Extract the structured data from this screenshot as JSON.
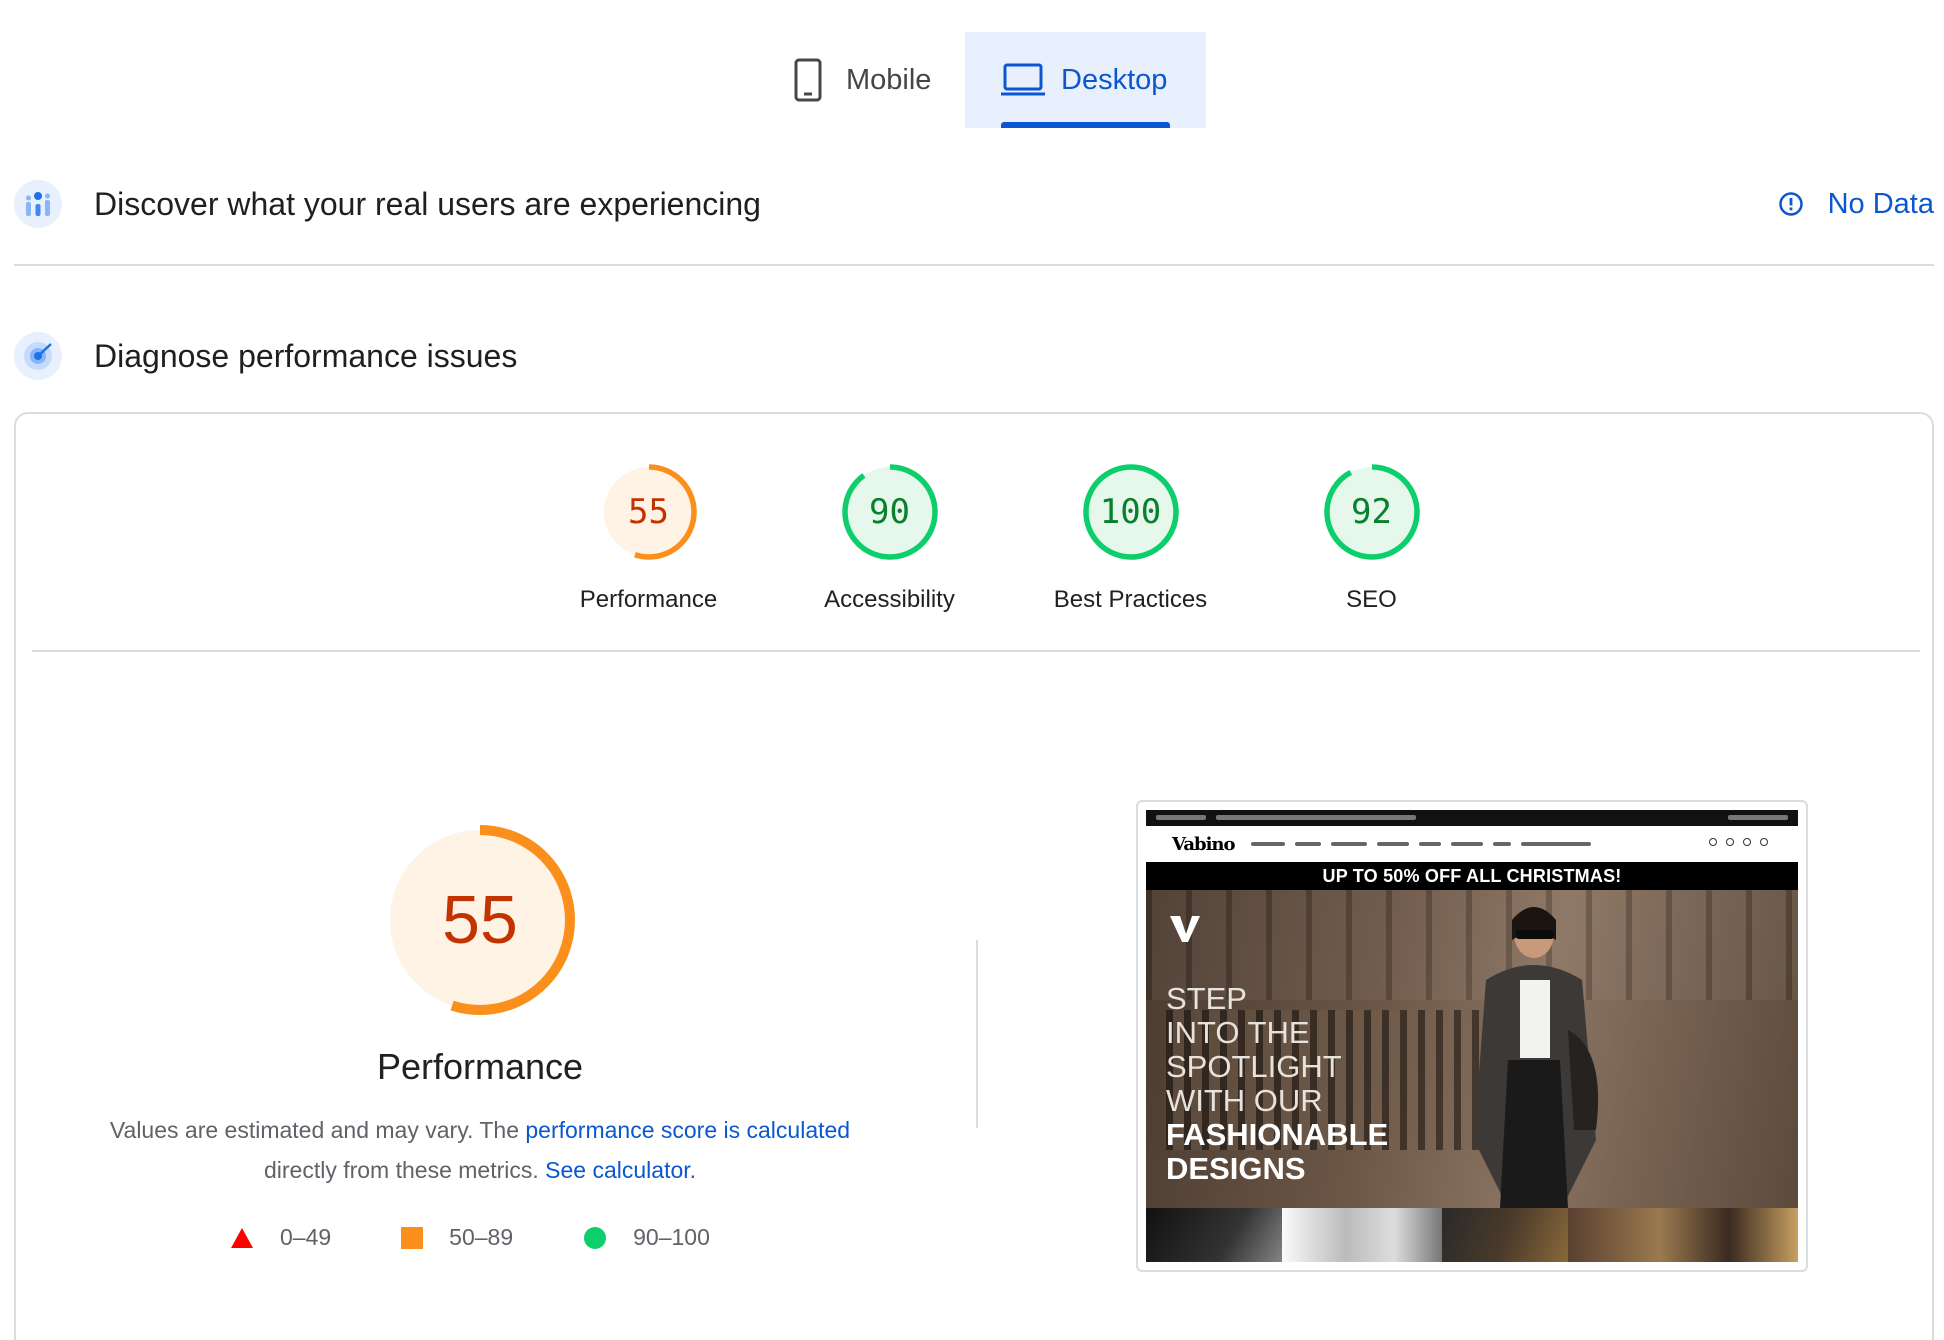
{
  "tabs": {
    "mobile_label": "Mobile",
    "desktop_label": "Desktop",
    "active": "Desktop"
  },
  "crux": {
    "title": "Discover what your real users are experiencing",
    "status": "No Data"
  },
  "diagnose": {
    "title": "Diagnose performance issues"
  },
  "categories": [
    {
      "label": "Performance",
      "score": "55",
      "value": 55,
      "color": "#fa901b",
      "text_color": "#c33300",
      "fill": "#fff3e6"
    },
    {
      "label": "Accessibility",
      "score": "90",
      "value": 90,
      "color": "#0cce6b",
      "text_color": "#08802c",
      "fill": "#e6f7ec"
    },
    {
      "label": "Best Practices",
      "score": "100",
      "value": 100,
      "color": "#0cce6b",
      "text_color": "#08802c",
      "fill": "#e6f7ec"
    },
    {
      "label": "SEO",
      "score": "92",
      "value": 92,
      "color": "#0cce6b",
      "text_color": "#08802c",
      "fill": "#e6f7ec"
    }
  ],
  "performance": {
    "score": "55",
    "value": 55,
    "title": "Performance",
    "desc_prefix": "Values are estimated and may vary. The ",
    "desc_link1": "performance score is calculated",
    "desc_middle": " directly from these metrics. ",
    "desc_link2": "See calculator."
  },
  "legend": [
    {
      "range": "0–49",
      "shape": "triangle",
      "color": "#ff0000"
    },
    {
      "range": "50–89",
      "shape": "square",
      "color": "#fa901b"
    },
    {
      "range": "90–100",
      "shape": "circle",
      "color": "#0cce6b"
    }
  ],
  "screenshot": {
    "logo": "Vabino",
    "banner": "UP TO 50% OFF ALL CHRISTMAS!",
    "hero_line1": "STEP",
    "hero_line2": "INTO THE",
    "hero_line3": "SPOTLIGHT",
    "hero_line4": "WITH OUR",
    "hero_line5": "FASHIONABLE",
    "hero_line6": "DESIGNS"
  },
  "icons": {
    "mobile": "phone-icon",
    "desktop": "laptop-icon",
    "crux": "crux-chart-icon",
    "diagnose": "lighthouse-target-icon",
    "info": "info-icon"
  },
  "colors": {
    "accent": "#0b57d0",
    "tab_active_bg": "#e8f0fe",
    "fail": "#ff0000",
    "average": "#fa901b",
    "pass": "#0cce6b"
  }
}
